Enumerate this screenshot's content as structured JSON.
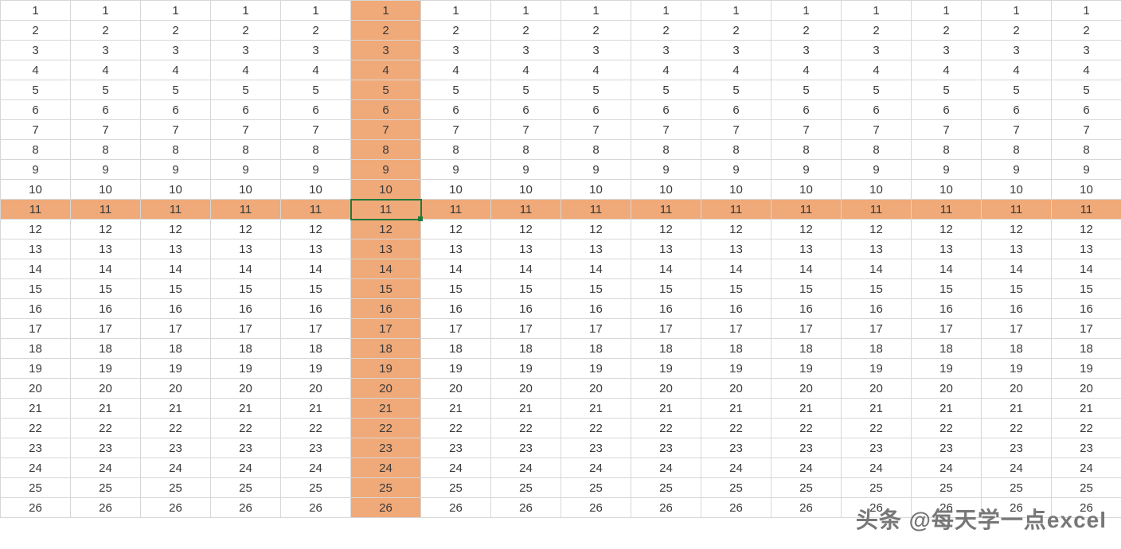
{
  "spreadsheet": {
    "rows": 26,
    "cols": 16,
    "highlight_row": 11,
    "highlight_col": 6,
    "selected": {
      "row": 11,
      "col": 6
    },
    "highlight_color": "#f0a978",
    "selection_border_color": "#1f7a3d",
    "cell_rule": "each cell displays its 1-based row index",
    "row_values": [
      1,
      2,
      3,
      4,
      5,
      6,
      7,
      8,
      9,
      10,
      11,
      12,
      13,
      14,
      15,
      16,
      17,
      18,
      19,
      20,
      21,
      22,
      23,
      24,
      25,
      26
    ]
  },
  "watermark": "头条 @每天学一点excel"
}
